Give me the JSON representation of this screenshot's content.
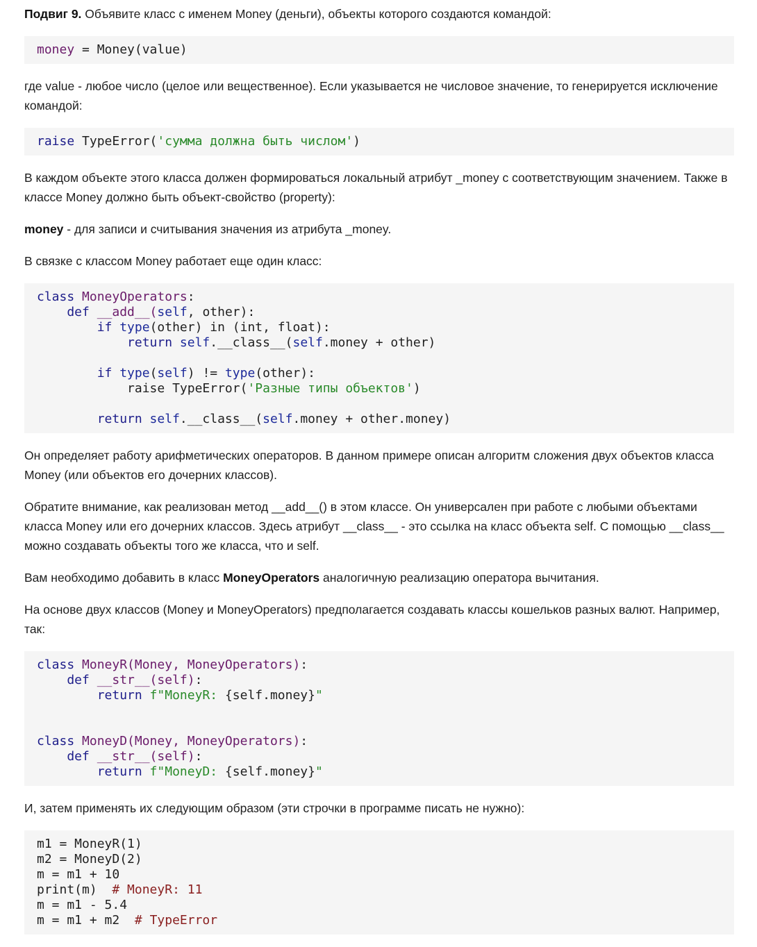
{
  "p1": {
    "bold": "Подвиг 9.",
    "rest": " Объявите класс с именем Money (деньги), объекты которого создаются командой:"
  },
  "code1": {
    "var": "money",
    "rest": " = Money(value)"
  },
  "p2": "где value - любое число (целое или вещественное). Если указывается не числовое значение, то генерируется исключение командой:",
  "code2": {
    "kw": "raise",
    "call": " TypeError(",
    "str": "'сумма должна быть числом'",
    "end": ")"
  },
  "p3": "В каждом объекте этого класса должен формироваться локальный атрибут _money с соответствующим значением. Также в классе Money должно быть объект-свойство (property):",
  "p4": {
    "bold": "money",
    "rest": " - для записи и считывания значения из атрибута _money."
  },
  "p5": "В связке с классом Money работает еще один класс:",
  "code3": {
    "l1_kw": "class",
    "l1_name": " MoneyOperators",
    "l1_end": ":",
    "l2_kw": "    def",
    "l2_fn": " __add__(",
    "l2_self": "self",
    "l2_end": ", other):",
    "l3_kw": "        if",
    "l3_bi": " type",
    "l3_mid": "(other) in (int, float):",
    "l4_kw": "            return",
    "l4_self": " self",
    "l4_mid": ".__class__(",
    "l4_self2": "self",
    "l4_end": ".money + other)",
    "l6_kw": "        if",
    "l6_bi": " type",
    "l6_p1": "(",
    "l6_self": "self",
    "l6_p2": ") != ",
    "l6_bi2": "type",
    "l6_end": "(other):",
    "l7_pre": "            raise TypeError(",
    "l7_str": "'Разные типы объектов'",
    "l7_end": ")",
    "l9_kw": "        return",
    "l9_self": " self",
    "l9_mid": ".__class__(",
    "l9_self2": "self",
    "l9_end": ".money + other.money)"
  },
  "p6": "Он определяет работу арифметических операторов. В данном примере описан алгоритм сложения двух объектов класса Money (или объектов его дочерних классов).",
  "p7": "Обратите внимание, как реализован метод __add__() в этом классе. Он универсален при работе с любыми объектами класса Money или его дочерних классов. Здесь атрибут __class__ - это ссылка на класс объекта self. С помощью __class__ можно создавать объекты того же класса, что и self.",
  "p8": {
    "pre": "Вам необходимо добавить в класс ",
    "bold": "MoneyOperators",
    "post": " аналогичную реализацию оператора вычитания."
  },
  "p9": "На основе двух классов (Money и MoneyOperators) предполагается создавать классы кошельков разных валют. Например, так:",
  "code4": {
    "a1_kw": "class",
    "a1_name": " MoneyR(Money, MoneyOperators)",
    "a1_end": ":",
    "a2_kw": "    def",
    "a2_fn": " __str__(self)",
    "a2_end": ":",
    "a3_kw": "        return",
    "a3_str": " f\"MoneyR: ",
    "a3_exp": "{self.money}",
    "a3_q": "\"",
    "b1_kw": "class",
    "b1_name": " MoneyD(Money, MoneyOperators)",
    "b1_end": ":",
    "b2_kw": "    def",
    "b2_fn": " __str__(self)",
    "b2_end": ":",
    "b3_kw": "        return",
    "b3_str": " f\"MoneyD: ",
    "b3_exp": "{self.money}",
    "b3_q": "\""
  },
  "p10": "И, затем применять их следующим образом (эти строчки в программе писать не нужно):",
  "code5": {
    "l1": "m1 = MoneyR(1)",
    "l2": "m2 = MoneyD(2)",
    "l3": "m = m1 + 10",
    "l4_code": "print(m)  ",
    "l4_cm": "# MoneyR: 11",
    "l5": "m = m1 - 5.4",
    "l6_code": "m = m1 + m2  ",
    "l6_cm": "# TypeError"
  }
}
